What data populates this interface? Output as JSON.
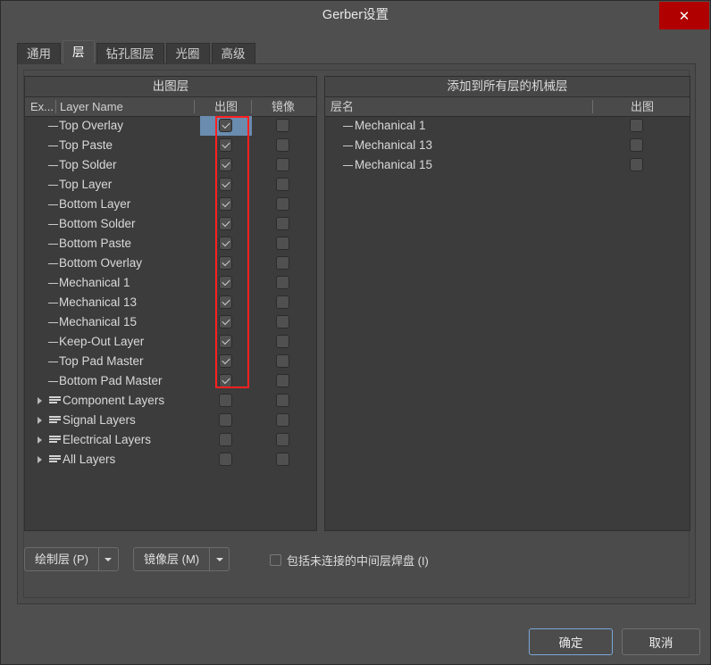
{
  "window": {
    "title": "Gerber设置",
    "close_label": "✕"
  },
  "tabs": [
    {
      "label": "通用",
      "active": false
    },
    {
      "label": "层",
      "active": true
    },
    {
      "label": "钻孔图层",
      "active": false
    },
    {
      "label": "光圈",
      "active": false
    },
    {
      "label": "高级",
      "active": false
    }
  ],
  "left_panel": {
    "title": "出图层",
    "columns": [
      "Ex...",
      "Layer Name",
      "出图",
      "镜像"
    ],
    "rows": [
      {
        "name": "Top Overlay",
        "kind": "leaf",
        "plot": true,
        "mirror": false,
        "selected": true
      },
      {
        "name": "Top Paste",
        "kind": "leaf",
        "plot": true,
        "mirror": false,
        "selected": false
      },
      {
        "name": "Top Solder",
        "kind": "leaf",
        "plot": true,
        "mirror": false,
        "selected": false
      },
      {
        "name": "Top Layer",
        "kind": "leaf",
        "plot": true,
        "mirror": false,
        "selected": false
      },
      {
        "name": "Bottom Layer",
        "kind": "leaf",
        "plot": true,
        "mirror": false,
        "selected": false
      },
      {
        "name": "Bottom Solder",
        "kind": "leaf",
        "plot": true,
        "mirror": false,
        "selected": false
      },
      {
        "name": "Bottom Paste",
        "kind": "leaf",
        "plot": true,
        "mirror": false,
        "selected": false
      },
      {
        "name": "Bottom Overlay",
        "kind": "leaf",
        "plot": true,
        "mirror": false,
        "selected": false
      },
      {
        "name": "Mechanical 1",
        "kind": "leaf",
        "plot": true,
        "mirror": false,
        "selected": false
      },
      {
        "name": "Mechanical 13",
        "kind": "leaf",
        "plot": true,
        "mirror": false,
        "selected": false
      },
      {
        "name": "Mechanical 15",
        "kind": "leaf",
        "plot": true,
        "mirror": false,
        "selected": false
      },
      {
        "name": "Keep-Out Layer",
        "kind": "leaf",
        "plot": true,
        "mirror": false,
        "selected": false
      },
      {
        "name": "Top Pad Master",
        "kind": "leaf",
        "plot": true,
        "mirror": false,
        "selected": false
      },
      {
        "name": "Bottom Pad Master",
        "kind": "leaf",
        "plot": true,
        "mirror": false,
        "selected": false
      },
      {
        "name": "Component Layers",
        "kind": "group",
        "plot": false,
        "mirror": false,
        "selected": false
      },
      {
        "name": "Signal Layers",
        "kind": "group",
        "plot": false,
        "mirror": false,
        "selected": false
      },
      {
        "name": "Electrical Layers",
        "kind": "group",
        "plot": false,
        "mirror": false,
        "selected": false
      },
      {
        "name": "All Layers",
        "kind": "group",
        "plot": false,
        "mirror": false,
        "selected": false
      }
    ]
  },
  "right_panel": {
    "title": "添加到所有层的机械层",
    "columns": [
      "层名",
      "出图"
    ],
    "rows": [
      {
        "name": "Mechanical 1",
        "plot": false
      },
      {
        "name": "Mechanical 13",
        "plot": false
      },
      {
        "name": "Mechanical 15",
        "plot": false
      }
    ]
  },
  "bottom_controls": {
    "plot_layers_button": {
      "label": "绘制层 (P)",
      "accel": "P"
    },
    "mirror_layers_button": {
      "label": "镜像层 (M)",
      "accel": "M"
    },
    "include_unconnected": {
      "label": "包括未连接的中间层焊盘 (I)",
      "accel": "I",
      "checked": false
    }
  },
  "footer": {
    "ok_label": "确定",
    "cancel_label": "取消"
  },
  "highlight": {
    "color": "#ff2020",
    "note": "出图 column checkboxes highlighted"
  },
  "colors": {
    "dialog_bg": "#4f4f4f",
    "panel_bg": "#3c3c3c",
    "selection_blue": "#6a8caf",
    "close_red": "#b00000",
    "highlight_red": "#ff2020",
    "focus_blue": "#7aa7d8"
  }
}
